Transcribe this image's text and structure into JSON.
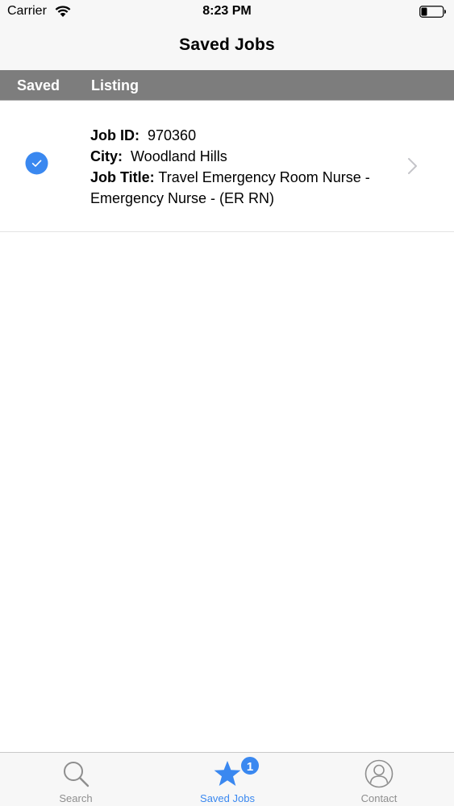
{
  "status_bar": {
    "carrier": "Carrier",
    "time": "8:23 PM"
  },
  "nav": {
    "title": "Saved Jobs"
  },
  "list_header": {
    "saved_label": "Saved",
    "listing_label": "Listing"
  },
  "jobs": [
    {
      "saved": true,
      "job_id_label": "Job ID:",
      "job_id": "970360",
      "city_label": "City:",
      "city": "Woodland Hills",
      "title_label": "Job Title:",
      "title_line1": "Travel Emergency Room Nurse -",
      "title_line2": "Emergency Nurse - (ER RN)"
    }
  ],
  "tab_bar": {
    "tabs": [
      {
        "label": "Search",
        "icon": "search-icon",
        "selected": false
      },
      {
        "label": "Saved Jobs",
        "icon": "star-icon",
        "selected": true,
        "badge": "1"
      },
      {
        "label": "Contact",
        "icon": "person-icon",
        "selected": false
      }
    ]
  },
  "colors": {
    "accent": "#3a88f0",
    "header_gray": "#7d7d7d",
    "chrome_bg": "#f7f7f7",
    "inactive_tab": "#8e8e8e"
  }
}
